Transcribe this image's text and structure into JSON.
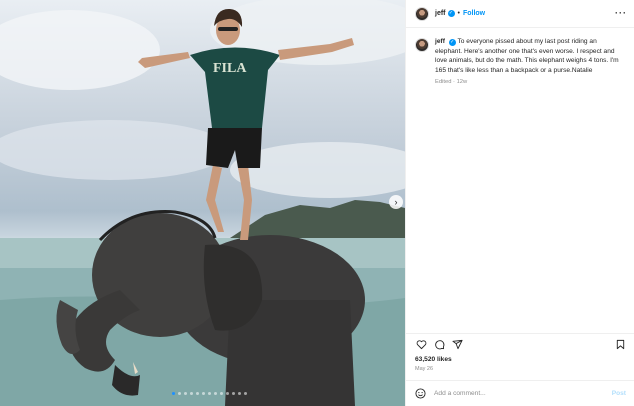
{
  "post": {
    "username": "jeff",
    "follow_label": "Follow",
    "separator": "•",
    "more_icon": "more-horizontal-icon",
    "verified_icon": "verified-badge-icon",
    "caption_text": "To everyone pissed about my last post riding an elephant. Here's another one that's even worse. I respect and love animals, but do the math. This elephant weighs 4 tons. I'm 165 that's like less than a backpack or a purse.Natalie",
    "edited": "Edited · 12w",
    "likes": "63,520 likes",
    "date": "May 26",
    "comment_placeholder": "Add a comment...",
    "post_label": "Post"
  },
  "actions": {
    "like_icon": "heart-icon",
    "comment_icon": "comment-icon",
    "share_icon": "send-icon",
    "save_icon": "bookmark-icon",
    "emoji_icon": "emoji-icon"
  },
  "carousel": {
    "total_slides": 13,
    "active_slide": 1,
    "next_icon": "chevron-right-icon"
  },
  "colors": {
    "accent": "#0095f6",
    "muted": "#8e8e8e",
    "post_disabled": "#b2dffc"
  }
}
